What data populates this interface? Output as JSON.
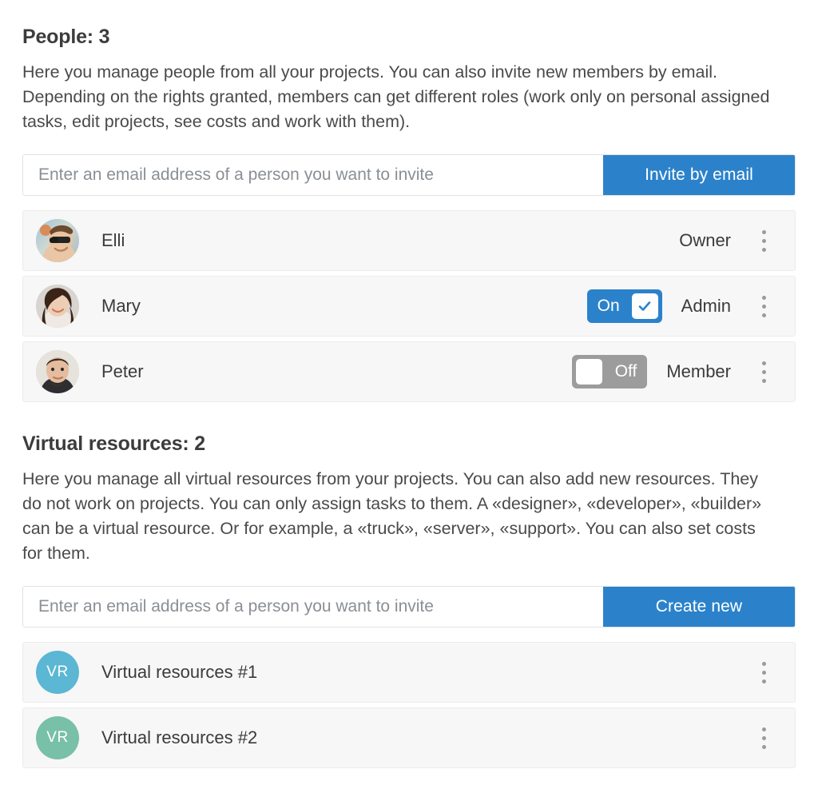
{
  "people_section": {
    "title": "People: 3",
    "description": "Here you manage people from all your projects. You can also invite new members by email. Depending on the rights granted, members can get different roles (work only on personal assigned tasks, edit projects, see costs and work with them).",
    "invite": {
      "placeholder": "Enter an email address of a person you want to invite",
      "value": "",
      "button_label": "Invite by email",
      "button_color": "#2b82ca"
    },
    "members": [
      {
        "name": "Elli",
        "role": "Owner",
        "avatar_type": "photo",
        "avatar_description": "man-with-sunglasses-photo",
        "toggle": null,
        "menu_icon": "kebab-menu-icon"
      },
      {
        "name": "Mary",
        "role": "Admin",
        "avatar_type": "photo",
        "avatar_description": "woman-smiling-photo",
        "toggle": {
          "state": "on",
          "label": "On",
          "color": "#2b82ca",
          "check_icon": "check-icon"
        },
        "menu_icon": "kebab-menu-icon"
      },
      {
        "name": "Peter",
        "role": "Member",
        "avatar_type": "photo",
        "avatar_description": "man-looking-up-photo",
        "toggle": {
          "state": "off",
          "label": "Off",
          "color": "#9c9c9c",
          "check_icon": null
        },
        "menu_icon": "kebab-menu-icon"
      }
    ]
  },
  "resources_section": {
    "title": "Virtual resources: 2",
    "description": "Here you manage all virtual resources from your projects. You can also add new resources. They do not work on projects. You can only assign tasks to them. A «designer», «developer», «builder» can be a virtual resource. Or for example, a «truck», «server», «support». You can also set costs for them.",
    "invite": {
      "placeholder": "Enter an email address of a person you want to invite",
      "value": "",
      "button_label": "Create new",
      "button_color": "#2b82ca"
    },
    "resources": [
      {
        "name": "Virtual resources #1",
        "avatar_initials": "VR",
        "avatar_color": "#5bb7d4",
        "menu_icon": "kebab-menu-icon"
      },
      {
        "name": "Virtual resources #2",
        "avatar_initials": "VR",
        "avatar_color": "#78c0a8",
        "menu_icon": "kebab-menu-icon"
      }
    ]
  }
}
